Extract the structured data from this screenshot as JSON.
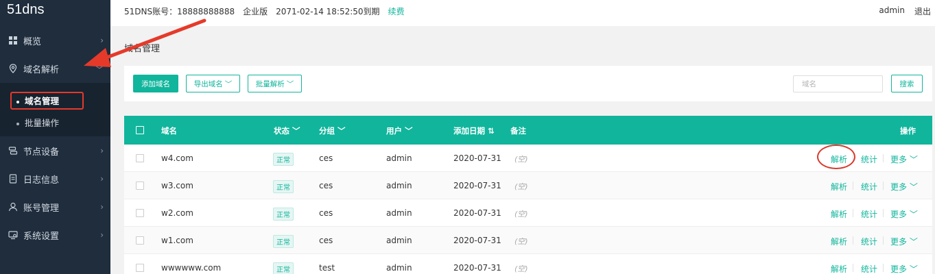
{
  "sidebar": {
    "brand": "51dns",
    "items": [
      {
        "label": "概览",
        "icon": "grid-icon"
      },
      {
        "label": "域名解析",
        "icon": "location-pin-icon"
      },
      {
        "label": "节点设备",
        "icon": "device-icon"
      },
      {
        "label": "日志信息",
        "icon": "document-icon"
      },
      {
        "label": "账号管理",
        "icon": "user-icon"
      },
      {
        "label": "系统设置",
        "icon": "settings-monitor-icon"
      }
    ],
    "sub_items": [
      {
        "label": "域名管理",
        "active": true
      },
      {
        "label": "批量操作",
        "active": false
      }
    ]
  },
  "header": {
    "account": "51DNS账号：18888888888",
    "edition": "企业版",
    "expiry": "2071-02-14 18:52:50到期",
    "renew": "续费",
    "user": "admin",
    "logout": "退出"
  },
  "page": {
    "title": "域名管理"
  },
  "toolbar": {
    "add_label": "添加域名",
    "export_label": "导出域名 ﹀",
    "batch_label": "批量解析 ﹀",
    "search_placeholder": "域名",
    "search_label": "搜索"
  },
  "table": {
    "headers": {
      "domain": "域名",
      "status": "状态 ﹀",
      "group": "分组 ﹀",
      "user": "用户 ﹀",
      "date": "添加日期 ⇅",
      "note": "备注",
      "actions": "操作"
    },
    "rows": [
      {
        "domain": "w4.com",
        "status": "正常",
        "group": "ces",
        "user": "admin",
        "date": "2020-07-31",
        "note": "(空)"
      },
      {
        "domain": "w3.com",
        "status": "正常",
        "group": "ces",
        "user": "admin",
        "date": "2020-07-31",
        "note": "(空)"
      },
      {
        "domain": "w2.com",
        "status": "正常",
        "group": "ces",
        "user": "admin",
        "date": "2020-07-31",
        "note": "(空)"
      },
      {
        "domain": "w1.com",
        "status": "正常",
        "group": "ces",
        "user": "admin",
        "date": "2020-07-31",
        "note": "(空)"
      },
      {
        "domain": "wwwwww.com",
        "status": "正常",
        "group": "test",
        "user": "admin",
        "date": "2020-07-31",
        "note": "(空)"
      }
    ],
    "action_labels": {
      "resolve": "解析",
      "stats": "统计",
      "more": "更多 ﹀"
    }
  },
  "colors": {
    "accent": "#10b59c",
    "sidebar_bg": "#1f2d3d",
    "annotation_red": "#e53a2a"
  }
}
